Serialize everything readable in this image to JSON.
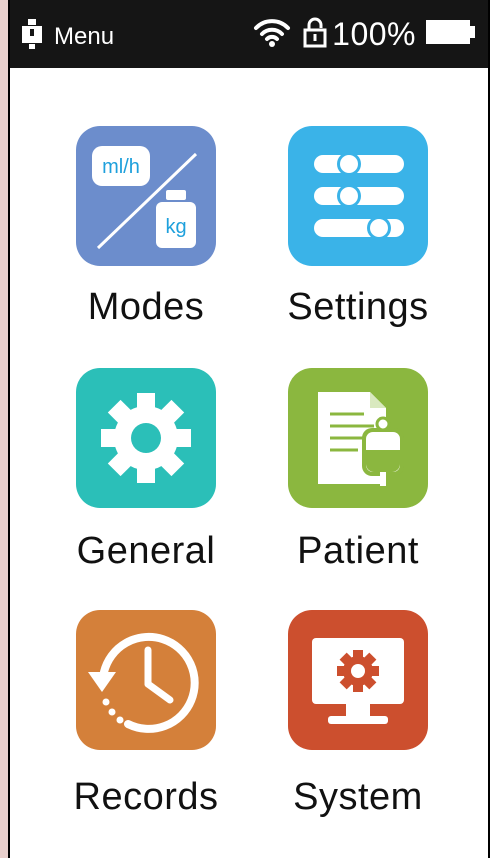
{
  "status_bar": {
    "title": "Menu",
    "battery_percent": "100%",
    "icons": [
      "device-icon",
      "wifi-icon",
      "lock-icon",
      "battery-icon"
    ]
  },
  "menu": {
    "items": [
      {
        "label": "Modes",
        "icon": "modes-icon",
        "color": "#6c8dcc",
        "inner_labels": {
          "rate": "ml/h",
          "weight": "kg"
        }
      },
      {
        "label": "Settings",
        "icon": "sliders-icon",
        "color": "#3ab3e8"
      },
      {
        "label": "General",
        "icon": "gear-icon",
        "color": "#2bbfb8"
      },
      {
        "label": "Patient",
        "icon": "patient-record-icon",
        "color": "#8bb73f"
      },
      {
        "label": "Records",
        "icon": "history-icon",
        "color": "#d4803a"
      },
      {
        "label": "System",
        "icon": "monitor-gear-icon",
        "color": "#cc4f2e"
      }
    ]
  }
}
